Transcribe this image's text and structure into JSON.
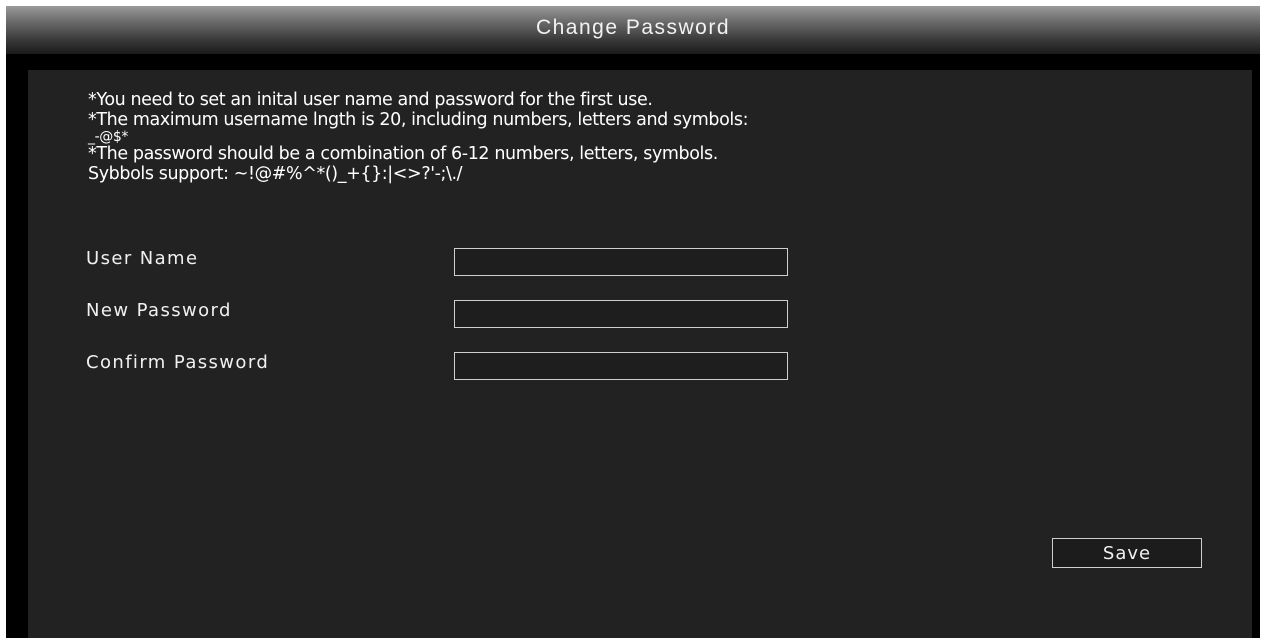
{
  "window": {
    "title": "Change Password"
  },
  "notes": {
    "line1": "*You need to set an inital user name and password for the first use.",
    "line2": "*The maximum username lngth is 20, including numbers, letters and symbols:",
    "line3": "_-@$*",
    "line4": "*The password should be a combination of 6-12 numbers, letters, symbols.",
    "line5": "Sybbols support: ~!@#%^*()_+{}:|<>?'-;\\./"
  },
  "form": {
    "username": {
      "label": "User Name",
      "value": ""
    },
    "new_password": {
      "label": "New Password",
      "value": ""
    },
    "confirm_password": {
      "label": "Confirm Password",
      "value": ""
    }
  },
  "actions": {
    "save_label": "Save"
  },
  "colors": {
    "panel_background": "#222222",
    "window_background": "#000000",
    "text": "#ffffff",
    "input_border": "#cfcfcf"
  }
}
